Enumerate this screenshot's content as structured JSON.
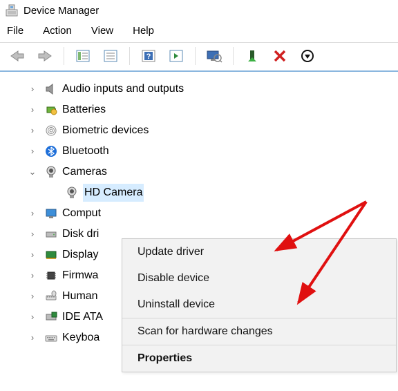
{
  "title": "Device Manager",
  "menu": {
    "file": "File",
    "action": "Action",
    "view": "View",
    "help": "Help"
  },
  "tree": {
    "audio": "Audio inputs and outputs",
    "batteries": "Batteries",
    "biometric": "Biometric devices",
    "bluetooth": "Bluetooth",
    "cameras": "Cameras",
    "hdcamera": "HD Camera",
    "computer": "Comput",
    "disk": "Disk dri",
    "display": "Display",
    "firmware": "Firmwa",
    "human": "Human",
    "ide": "IDE ATA",
    "keyboard": "Keyboa"
  },
  "context": {
    "update": "Update driver",
    "disable": "Disable device",
    "uninstall": "Uninstall device",
    "scan": "Scan for hardware changes",
    "properties": "Properties"
  }
}
